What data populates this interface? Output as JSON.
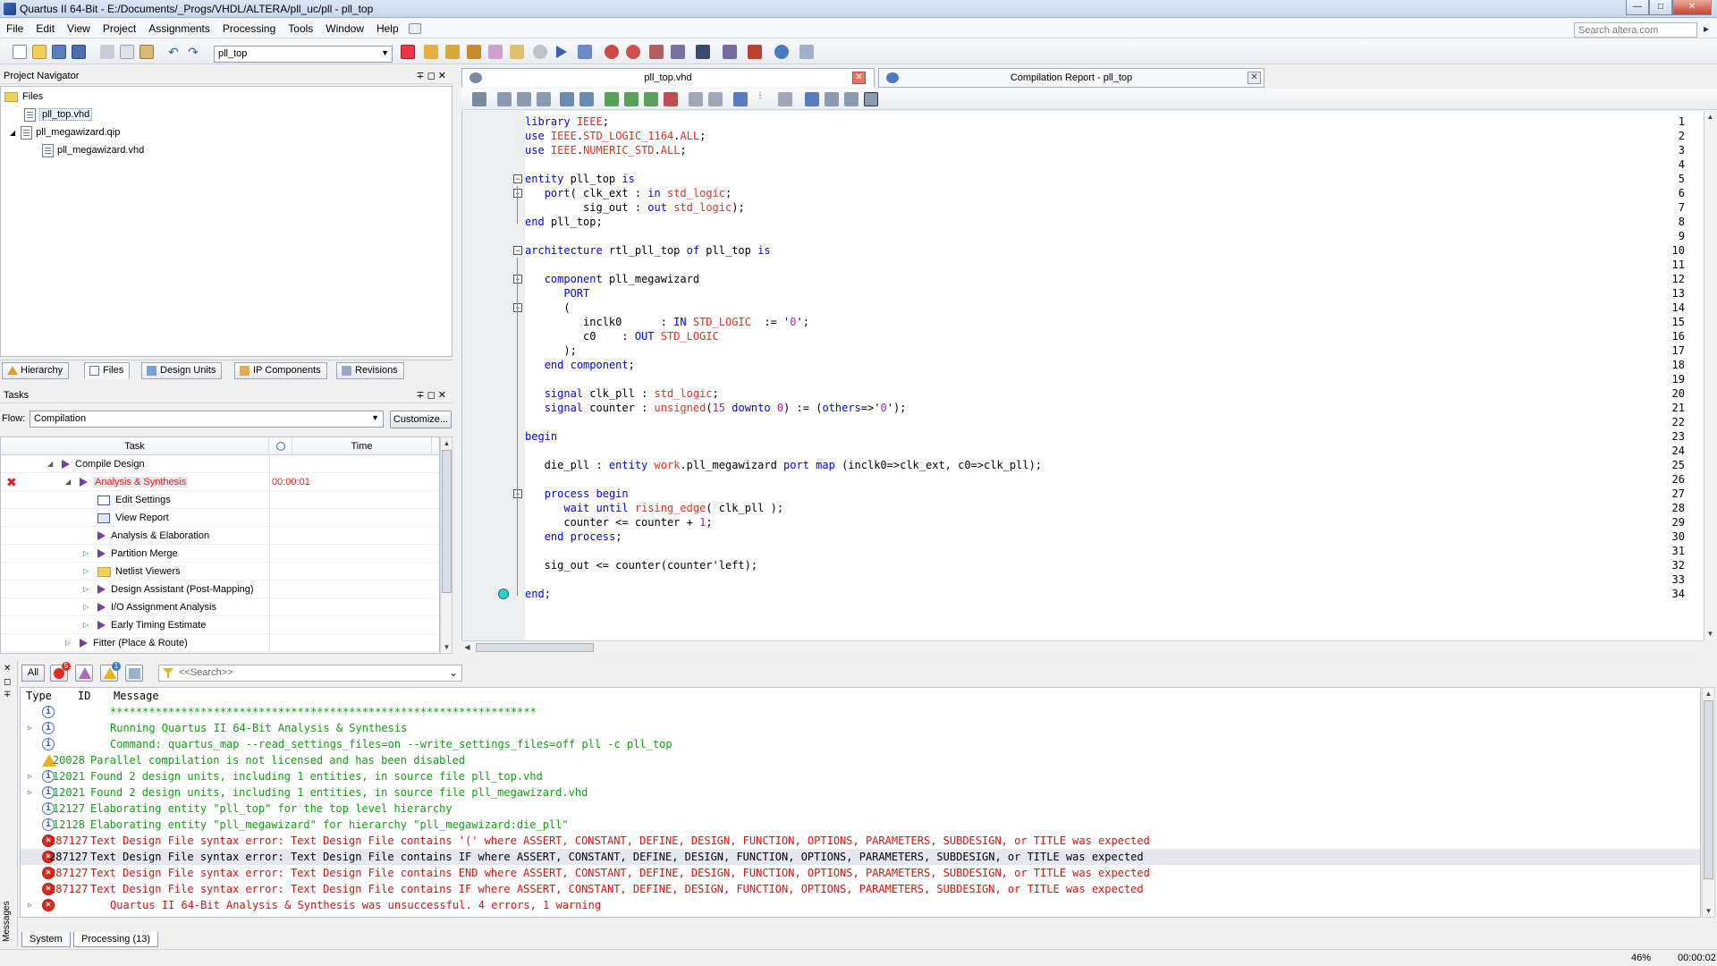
{
  "window": {
    "title": "Quartus II 64-Bit - E:/Documents/_Progs/VHDL/ALTERA/pll_uc/pll - pll_top"
  },
  "menu": [
    "File",
    "Edit",
    "View",
    "Project",
    "Assignments",
    "Processing",
    "Tools",
    "Window",
    "Help"
  ],
  "search": {
    "placeholder": "Search altera.com"
  },
  "toolbar": {
    "project_combo": "pll_top"
  },
  "navigator": {
    "title": "Project Navigator",
    "files_root": "Files",
    "items": [
      "pll_top.vhd",
      "pll_megawizard.qip",
      "pll_megawizard.vhd"
    ],
    "tabs": [
      "Hierarchy",
      "Files",
      "Design Units",
      "IP Components",
      "Revisions"
    ]
  },
  "tasks": {
    "title": "Tasks",
    "flow_label": "Flow:",
    "flow_value": "Compilation",
    "customize": "Customize...",
    "col_task": "Task",
    "col_time": "Time",
    "rows": [
      {
        "label": "Compile Design",
        "time": ""
      },
      {
        "label": "Analysis & Synthesis",
        "time": "00:00:01"
      },
      {
        "label": "Edit Settings",
        "time": ""
      },
      {
        "label": "View Report",
        "time": ""
      },
      {
        "label": "Analysis & Elaboration",
        "time": ""
      },
      {
        "label": "Partition Merge",
        "time": ""
      },
      {
        "label": "Netlist Viewers",
        "time": ""
      },
      {
        "label": "Design Assistant (Post-Mapping)",
        "time": ""
      },
      {
        "label": "I/O Assignment Analysis",
        "time": ""
      },
      {
        "label": "Early Timing Estimate",
        "time": ""
      },
      {
        "label": "Fitter (Place & Route)",
        "time": ""
      }
    ]
  },
  "editor": {
    "tabs": [
      "pll_top.vhd",
      "Compilation Report - pll_top"
    ],
    "lines": [
      "library IEEE;",
      "use IEEE.STD_LOGIC_1164.ALL;",
      "use IEEE.NUMERIC_STD.ALL;",
      "",
      "entity pll_top is",
      "   port( clk_ext : in std_logic;",
      "         sig_out : out std_logic);",
      "end pll_top;",
      "",
      "architecture rtl_pll_top of pll_top is",
      "",
      "   component pll_megawizard",
      "      PORT",
      "      (",
      "         inclk0      : IN STD_LOGIC  := '0';",
      "         c0    : OUT STD_LOGIC",
      "      );",
      "   end component;",
      "",
      "   signal clk_pll : std_logic;",
      "   signal counter : unsigned(15 downto 0) := (others=>'0');",
      "",
      "begin",
      "",
      "   die_pll : entity work.pll_megawizard port map (inclk0=>clk_ext, c0=>clk_pll);",
      "",
      "   process begin",
      "      wait until rising_edge( clk_pll );",
      "      counter <= counter + 1;",
      "   end process;",
      "",
      "   sig_out <= counter(counter'left);",
      "",
      "end;"
    ]
  },
  "messages": {
    "filter_all": "All",
    "error_count": "5",
    "info_count": "1",
    "search_placeholder": "<<Search>>",
    "col_type": "Type",
    "col_id": "ID",
    "col_message": "Message",
    "side_label": "Messages",
    "rows": [
      {
        "type": "info",
        "id": "",
        "text": "******************************************************************",
        "color": "green"
      },
      {
        "type": "info",
        "id": "",
        "text": "Running Quartus II 64-Bit Analysis & Synthesis",
        "color": "green"
      },
      {
        "type": "info",
        "id": "",
        "text": "Command: quartus_map --read_settings_files=on --write_settings_files=off pll -c pll_top",
        "color": "green"
      },
      {
        "type": "warn",
        "id": "20028",
        "text": "Parallel compilation is not licensed and has been disabled",
        "color": "green"
      },
      {
        "type": "info",
        "id": "12021",
        "text": "Found 2 design units, including 1 entities, in source file pll_top.vhd",
        "color": "green"
      },
      {
        "type": "info",
        "id": "12021",
        "text": "Found 2 design units, including 1 entities, in source file pll_megawizard.vhd",
        "color": "green"
      },
      {
        "type": "info",
        "id": "12127",
        "text": "Elaborating entity \"pll_top\" for the top level hierarchy",
        "color": "green"
      },
      {
        "type": "info",
        "id": "12128",
        "text": "Elaborating entity \"pll_megawizard\" for hierarchy \"pll_megawizard:die_pll\"",
        "color": "green"
      },
      {
        "type": "err",
        "id": "287127",
        "text": "Text Design File syntax error: Text Design File contains '(' where ASSERT, CONSTANT, DEFINE, DESIGN, FUNCTION, OPTIONS, PARAMETERS, SUBDESIGN, or TITLE was expected",
        "color": "red"
      },
      {
        "type": "err",
        "id": "287127",
        "text": "Text Design File syntax error: Text Design File contains IF where ASSERT, CONSTANT, DEFINE, DESIGN, FUNCTION, OPTIONS, PARAMETERS, SUBDESIGN, or TITLE was expected",
        "color": "blk"
      },
      {
        "type": "err",
        "id": "287127",
        "text": "Text Design File syntax error: Text Design File contains END where ASSERT, CONSTANT, DEFINE, DESIGN, FUNCTION, OPTIONS, PARAMETERS, SUBDESIGN, or TITLE was expected",
        "color": "red"
      },
      {
        "type": "err",
        "id": "287127",
        "text": "Text Design File syntax error: Text Design File contains IF where ASSERT, CONSTANT, DEFINE, DESIGN, FUNCTION, OPTIONS, PARAMETERS, SUBDESIGN, or TITLE was expected",
        "color": "red"
      },
      {
        "type": "err",
        "id": "",
        "text": "Quartus II 64-Bit Analysis & Synthesis was unsuccessful. 4 errors, 1 warning",
        "color": "red"
      }
    ],
    "tabs": [
      "System",
      "Processing (13)"
    ]
  },
  "status": {
    "zoom": "46%",
    "elapsed": "00:00:02"
  }
}
